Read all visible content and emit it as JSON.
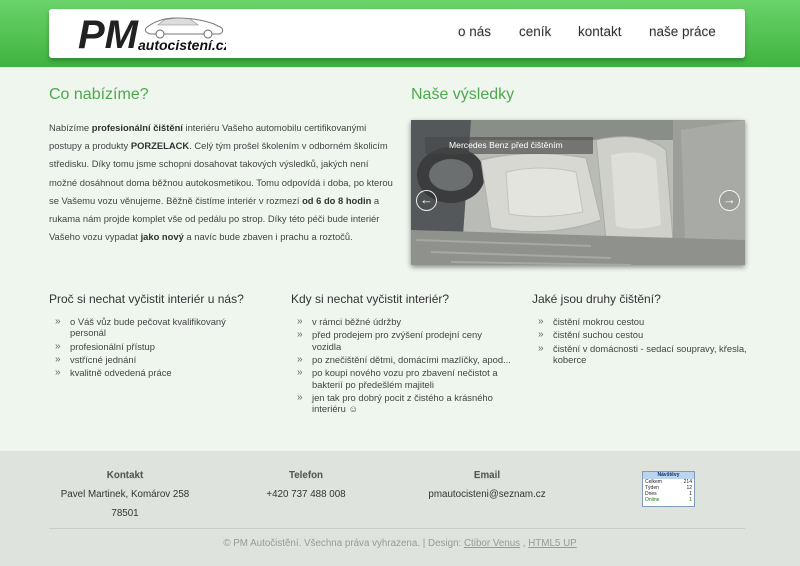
{
  "colors": {
    "accent_green": "#4ea84e",
    "header_green": "#4cbf4c",
    "text": "#444444"
  },
  "header": {
    "logo": {
      "big": "PM",
      "small": "autocistení.cz"
    },
    "nav": [
      "o nás",
      "ceník",
      "kontakt",
      "naše práce"
    ]
  },
  "offer": {
    "title": "Co nabízíme?",
    "paragraph": [
      {
        "t": "Nabízíme "
      },
      {
        "t": "profesionální čištění",
        "b": true
      },
      {
        "t": " interiéru Vašeho automobilu certifikovanými postupy a produkty "
      },
      {
        "t": "PORZELACK",
        "b": true
      },
      {
        "t": ". Celý tým prošel školením v odborném školicím středisku. Díky tomu jsme schopni dosahovat takových výsledků, jakých není možné dosáhnout doma běžnou autokosmetikou. Tomu odpovídá i doba, po kterou se Vašemu vozu věnujeme. Běžně čistíme interiér v rozmezí "
      },
      {
        "t": "od 6 do 8 hodin",
        "b": true
      },
      {
        "t": " a rukama nám projde komplet vše od pedálu po strop. Díky této péči bude interiér Vašeho vozu vypadat "
      },
      {
        "t": "jako nový",
        "b": true
      },
      {
        "t": " a navíc bude zbaven i prachu a roztočů."
      }
    ]
  },
  "results": {
    "title": "Naše výsledky",
    "caption": "Mercedes Benz před čištěním",
    "prev_icon": "arrow-left-icon",
    "next_icon": "arrow-right-icon"
  },
  "columns": [
    {
      "title": "Proč si nechat vyčistit interiér u nás?",
      "items": [
        "o Váš vůz bude pečovat kvalifikovaný personál",
        "profesionální přístup",
        "vstřícné jednání",
        "kvalitně odvedená práce"
      ]
    },
    {
      "title": "Kdy si nechat vyčistit interiér?",
      "items": [
        "v rámci běžné údržby",
        "před prodejem pro zvýšení prodejní ceny vozidla",
        "po znečištění dětmi, domácími mazlíčky, apod...",
        "po koupi nového vozu pro zbavení nečistot a bakterií po předešlém majiteli",
        "jen tak pro dobrý pocit z čistého a krásného interiéru ☺"
      ]
    },
    {
      "title": "Jaké jsou druhy čištění?",
      "items": [
        "čistění mokrou cestou",
        "čistění suchou cestou",
        "čistění v domácnosti - sedací soupravy, křesla, koberce"
      ]
    }
  ],
  "footer": {
    "contact": {
      "label": "Kontakt",
      "line1": "Pavel Martinek, Komárov 258",
      "line2": "78501"
    },
    "phone": {
      "label": "Telefon",
      "value": "+420 737 488 008"
    },
    "email": {
      "label": "Email",
      "value": "pmautocisteni@seznam.cz"
    },
    "counter": {
      "title": "Návštěvy",
      "rows": [
        {
          "label": "Celkem",
          "value": "214"
        },
        {
          "label": "Týden",
          "value": "12"
        },
        {
          "label": "Dnes",
          "value": "1"
        },
        {
          "label": "Online",
          "value": "1"
        }
      ]
    },
    "copyright": "© PM Autočistění. Všechna práva vyhrazena. | Design: ",
    "designer_link": "Ctibor Venus",
    "separator": " , ",
    "template_link": "HTML5 UP"
  }
}
